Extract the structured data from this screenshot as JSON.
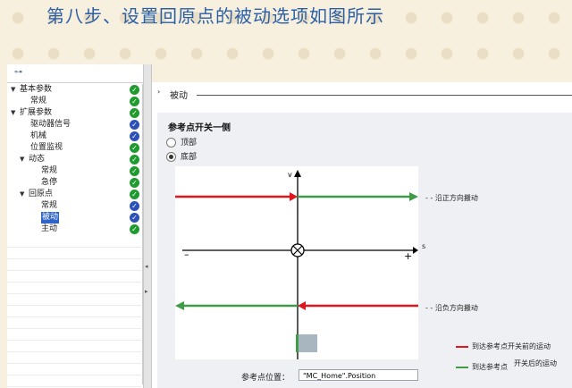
{
  "slide_title": "第八步、设置回原点的被动选项如图所示",
  "tree": {
    "items": [
      {
        "label": "基本参数",
        "level": 0,
        "expander": "▼",
        "status": "ok"
      },
      {
        "label": "常规",
        "level": 2,
        "status": "ok"
      },
      {
        "label": "扩展参数",
        "level": 0,
        "expander": "▼",
        "status": "ok"
      },
      {
        "label": "驱动器信号",
        "level": 2,
        "status": "info"
      },
      {
        "label": "机械",
        "level": 2,
        "status": "info"
      },
      {
        "label": "位置监视",
        "level": 2,
        "status": "ok"
      },
      {
        "label": "动态",
        "level": 1,
        "expander": "▼",
        "status": "ok"
      },
      {
        "label": "常规",
        "level": 3,
        "status": "ok"
      },
      {
        "label": "急停",
        "level": 3,
        "status": "ok"
      },
      {
        "label": "回原点",
        "level": 1,
        "expander": "▼",
        "status": "ok"
      },
      {
        "label": "常规",
        "level": 3,
        "status": "info"
      },
      {
        "label": "被动",
        "level": 3,
        "status": "info",
        "selected": true
      },
      {
        "label": "主动",
        "level": 3,
        "status": "ok"
      }
    ]
  },
  "section": {
    "chevron": "›",
    "title": "被动"
  },
  "group": {
    "title": "参考点开关一侧",
    "options": [
      {
        "label": "顶部",
        "checked": false
      },
      {
        "label": "底部",
        "checked": true
      }
    ]
  },
  "diagram": {
    "axis_v": "v",
    "axis_s": "s",
    "minus": "–",
    "plus": "+",
    "positive_note": "沿正方向搬动",
    "negative_note": "沿负方向搬动",
    "colors": {
      "before": "#e0161e",
      "after": "#3f9b47"
    }
  },
  "legend": {
    "before": "到达参考点开关前的运动",
    "after_part1": "到达参考点",
    "after_part2": "开关后的运动"
  },
  "ref_position": {
    "label": "参考点位置：",
    "value": "\"MC_Home\".Position"
  }
}
